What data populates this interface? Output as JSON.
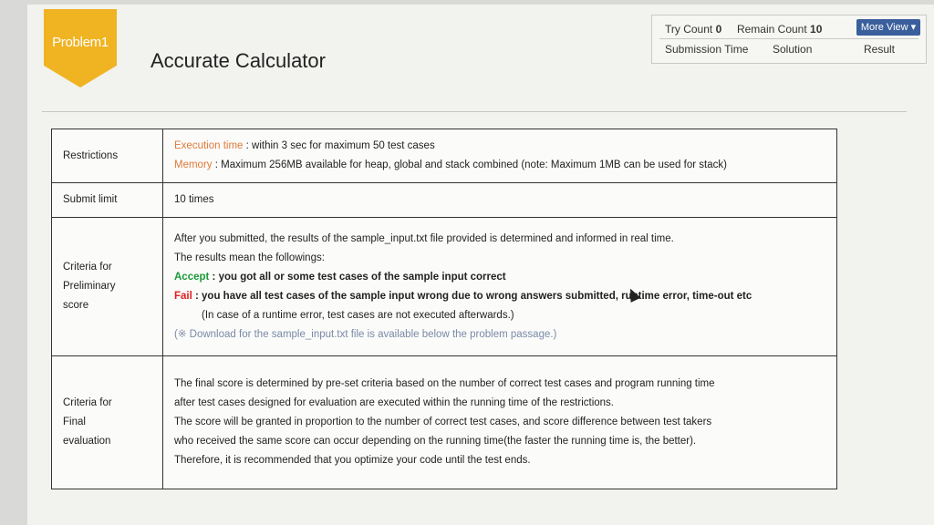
{
  "problem": {
    "badge": "Problem1",
    "title": "Accurate Calculator"
  },
  "info": {
    "try_count_label": "Try Count",
    "try_count": "0",
    "remain_count_label": "Remain Count",
    "remain_count": "10",
    "more_view_label": "More View",
    "columns": [
      "Submission Time",
      "Solution",
      "Result"
    ]
  },
  "restrictions": {
    "label": "Restrictions",
    "exec_label": "Execution time",
    "exec_text": " : within 3 sec for maximum 50 test cases",
    "memory_label": "Memory",
    "memory_text": " : Maximum 256MB available for heap, global and stack combined (note: Maximum 1MB can be used for stack)"
  },
  "submit_limit": {
    "label": "Submit limit",
    "value": "10 times"
  },
  "preliminary": {
    "label_lines": [
      "Criteria for",
      "Preliminary",
      "score"
    ],
    "line1": "After you submitted, the results of the sample_input.txt file provided is determined and informed in real time.",
    "line2": "The results mean the followings:",
    "accept_label": "Accept",
    "accept_text": " : you got all or some test cases of the sample input correct",
    "fail_label": "Fail",
    "fail_text": " : you have all test cases of the sample input wrong due to wrong answers submitted, runtime error, time-out etc",
    "note": "(In case of a runtime error, test cases are not executed afterwards.)",
    "download_note": "(※ Download for the sample_input.txt file is available below the problem passage.)"
  },
  "final": {
    "label_lines": [
      "Criteria for",
      "Final",
      "evaluation"
    ],
    "lines": [
      "The final score is determined by pre-set criteria based on the number of correct test cases and program running time",
      "after test cases designed for evaluation are executed within the running time of the restrictions.",
      "The score will be granted in proportion to the number of correct test cases, and score difference between test takers",
      "who received the same score can occur depending on the running time(the faster the running time is, the better).",
      "Therefore, it is recommended that you optimize your code until the test ends."
    ]
  }
}
